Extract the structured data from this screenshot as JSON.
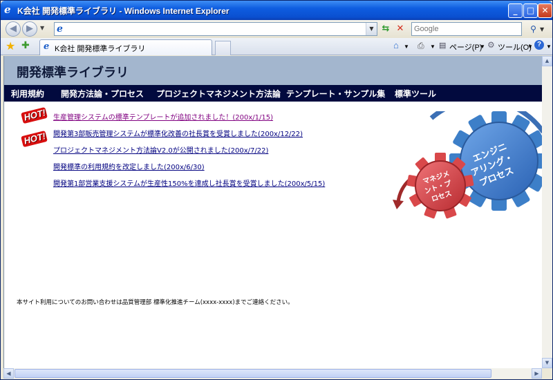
{
  "window": {
    "title": "K会社 開発標準ライブラリ - Windows Internet Explorer",
    "minimize": "_",
    "maximize": "□",
    "close": "✕"
  },
  "toolbar": {
    "address_value": "",
    "search_placeholder": "Google",
    "back_icon": "back-arrow-icon",
    "forward_icon": "forward-arrow-icon"
  },
  "tab": {
    "label": "K会社 開発標準ライブラリ"
  },
  "commands": {
    "page": "ページ(P)",
    "tools": "ツール(O)"
  },
  "site": {
    "title": "開発標準ライブラリ",
    "menu": [
      "利用規約",
      "開発方法論・プロセス",
      "プロジェクトマネジメント方法論",
      "テンプレート・サンプル集",
      "標準ツール"
    ],
    "hot_badge": "HOT!",
    "news": [
      {
        "text": "生産管理システムの標準テンプレートが追加されました！(200x/1/15)",
        "hot": true,
        "color": "#800080"
      },
      {
        "text": "開発第3部販売管理システムが標準化改善の社長賞を受賞しました(200x/12/22)",
        "hot": true,
        "color": "#000080"
      },
      {
        "text": "プロジェクトマネジメント方法論V2.0が公開されました(200x/7/22)",
        "hot": false,
        "color": "#000080"
      },
      {
        "text": "開発標準の利用規約を改定しました(200x/6/30)",
        "hot": false,
        "color": "#000080"
      },
      {
        "text": "開発第1部営業支援システムが生産性150%を達成し社長賞を受賞しました(200x/5/15)",
        "hot": false,
        "color": "#000080"
      }
    ],
    "graphic": {
      "big_gear": [
        "エンジニ",
        "アリング・",
        "プロセス"
      ],
      "small_gear": [
        "マネジメ",
        "ント・プ",
        "ロセス"
      ],
      "big_gear_color": "#3D7FC8",
      "small_gear_color": "#D9484A"
    },
    "footer": "本サイト利用についてのお問い合わせは品質管理部 標準化推進チーム(xxxx-xxxx)までご連絡ください。"
  }
}
